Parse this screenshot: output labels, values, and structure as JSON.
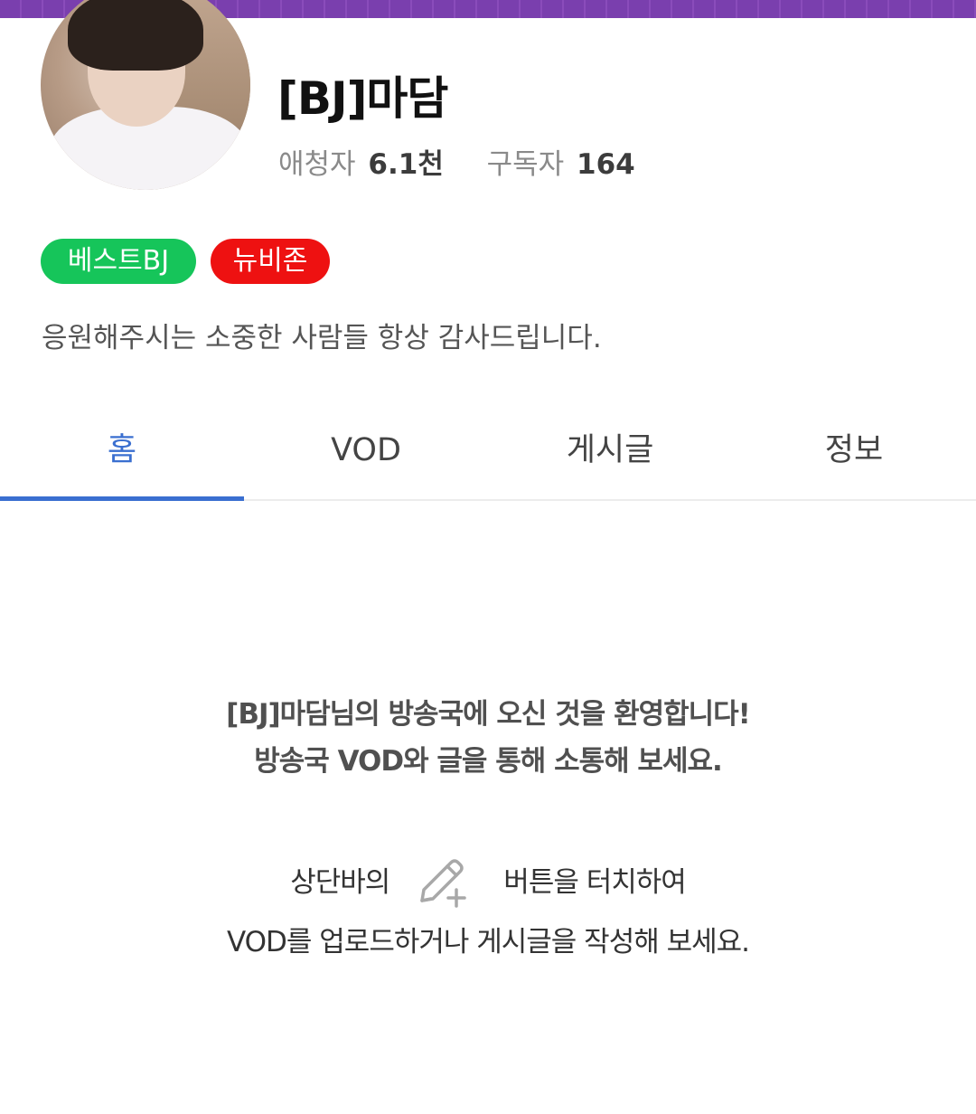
{
  "profile": {
    "name": "[BJ]마담",
    "viewers_label": "애청자",
    "viewers_value": "6.1천",
    "subscribers_label": "구독자",
    "subscribers_value": "164",
    "bio": "응원해주시는 소중한 사람들 항상 감사드립니다."
  },
  "badges": {
    "best": "베스트BJ",
    "new": "뉴비존"
  },
  "tabs": {
    "home": "홈",
    "vod": "VOD",
    "posts": "게시글",
    "info": "정보"
  },
  "welcome": {
    "line1": "[BJ]마담님의 방송국에 오신 것을 환영합니다!",
    "line2": "방송국 VOD와 글을 통해 소통해 보세요."
  },
  "hint": {
    "before_icon": "상단바의",
    "after_icon": "버튼을 터치하여",
    "line2": "VOD를 업로드하거나 게시글을 작성해 보세요."
  },
  "icons": {
    "write": "pencil-plus-icon"
  },
  "colors": {
    "accent": "#3a6fd0",
    "top_band": "#7a3fae",
    "badge_best": "#16c55a",
    "badge_new": "#ee1111"
  }
}
